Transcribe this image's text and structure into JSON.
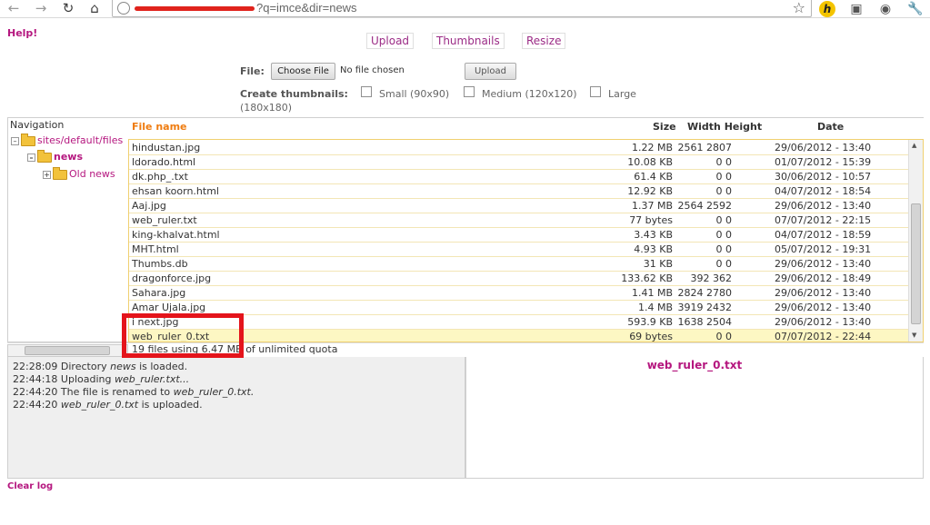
{
  "browser": {
    "url_suffix": "?q=imce&dir=news"
  },
  "page": {
    "help": "Help!",
    "ops": {
      "upload": "Upload",
      "thumbnails": "Thumbnails",
      "resize": "Resize"
    },
    "form": {
      "file_label": "File:",
      "choose_file": "Choose File",
      "no_file": "No file chosen",
      "upload_button": "Upload",
      "thumbs_label": "Create thumbnails:",
      "thumb_small": "Small (90x90)",
      "thumb_medium": "Medium (120x120)",
      "thumb_large": "Large",
      "thumb_large_dim": "(180x180)"
    },
    "navigation": {
      "title": "Navigation",
      "root": "sites/default/files",
      "current": "news",
      "child": "Old news"
    },
    "file_list": {
      "columns": {
        "name": "File name",
        "size": "Size",
        "dims": "Width Height",
        "date": "Date"
      },
      "rows": [
        {
          "name": "hindustan.jpg",
          "size": "1.22 MB",
          "dims": "2561 2807",
          "date": "29/06/2012 - 13:40"
        },
        {
          "name": "ldorado.html",
          "size": "10.08 KB",
          "dims": "0 0",
          "date": "01/07/2012 - 15:39"
        },
        {
          "name": "dk.php_.txt",
          "size": "61.4 KB",
          "dims": "0 0",
          "date": "30/06/2012 - 10:57"
        },
        {
          "name": "ehsan koorn.html",
          "size": "12.92 KB",
          "dims": "0 0",
          "date": "04/07/2012 - 18:54"
        },
        {
          "name": "Aaj.jpg",
          "size": "1.37 MB",
          "dims": "2564 2592",
          "date": "29/06/2012 - 13:40"
        },
        {
          "name": "web_ruler.txt",
          "size": "77 bytes",
          "dims": "0 0",
          "date": "07/07/2012 - 22:15"
        },
        {
          "name": "king-khalvat.html",
          "size": "3.43 KB",
          "dims": "0 0",
          "date": "04/07/2012 - 18:59"
        },
        {
          "name": "MHT.html",
          "size": "4.93 KB",
          "dims": "0 0",
          "date": "05/07/2012 - 19:31"
        },
        {
          "name": "Thumbs.db",
          "size": "31 KB",
          "dims": "0 0",
          "date": "29/06/2012 - 13:40"
        },
        {
          "name": "dragonforce.jpg",
          "size": "133.62 KB",
          "dims": "392 362",
          "date": "29/06/2012 - 18:49"
        },
        {
          "name": "Sahara.jpg",
          "size": "1.41 MB",
          "dims": "2824 2780",
          "date": "29/06/2012 - 13:40"
        },
        {
          "name": "Amar Ujala.jpg",
          "size": "1.4 MB",
          "dims": "3919 2432",
          "date": "29/06/2012 - 13:40"
        },
        {
          "name": "i next.jpg",
          "size": "593.9 KB",
          "dims": "1638 2504",
          "date": "29/06/2012 - 13:40"
        },
        {
          "name": "web_ruler_0.txt",
          "size": "69 bytes",
          "dims": "0 0",
          "date": "07/07/2012 - 22:44"
        }
      ],
      "quota": "19 files using 6.47 MB of unlimited quota"
    },
    "log": [
      {
        "time": "22:28:09",
        "pre": "Directory ",
        "em": "news",
        "post": " is loaded."
      },
      {
        "time": "22:44:18",
        "pre": "Uploading ",
        "em": "web_ruler.txt...",
        "post": ""
      },
      {
        "time": "22:44:20",
        "pre": "The file is renamed to ",
        "em": "web_ruler_0.txt.",
        "post": ""
      },
      {
        "time": "22:44:20",
        "pre": "",
        "em": "web_ruler_0.txt",
        "post": " is uploaded."
      }
    ],
    "preview": "web_ruler_0.txt",
    "clear_log": "Clear log"
  },
  "colors": {
    "accent": "#b5177f",
    "header_orange": "#ef7c10",
    "highlight_row": "#fdf7c3",
    "annotation": "#e4141b"
  }
}
